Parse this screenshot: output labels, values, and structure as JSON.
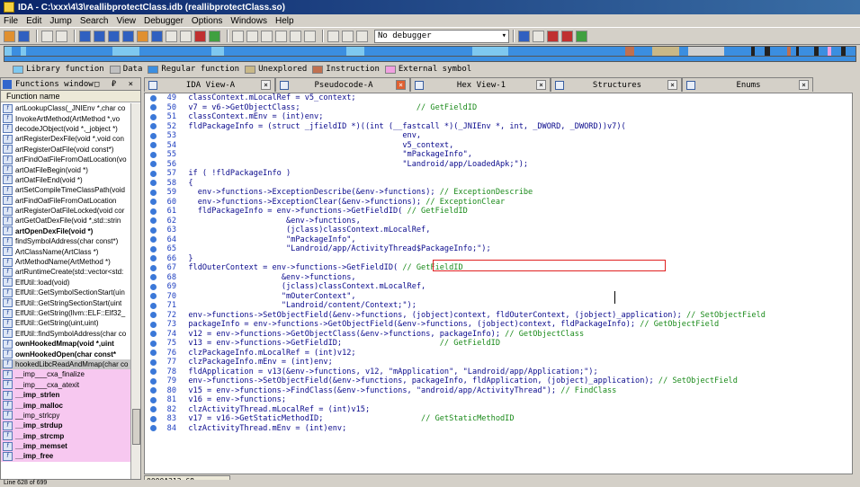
{
  "window": {
    "title": "IDA - C:\\xxx\\4\\3\\reallibprotectClass.idb (reallibprotectClass.so)"
  },
  "menu": [
    "File",
    "Edit",
    "Jump",
    "Search",
    "View",
    "Debugger",
    "Options",
    "Windows",
    "Help"
  ],
  "toolbar": {
    "debugger_select": "No debugger"
  },
  "legend": [
    {
      "label": "Library function",
      "color": "#7ec8f0"
    },
    {
      "label": "Data",
      "color": "#c0c0c0"
    },
    {
      "label": "Regular function",
      "color": "#3b8ee0"
    },
    {
      "label": "Unexplored",
      "color": "#c8b888"
    },
    {
      "label": "Instruction",
      "color": "#c07050"
    },
    {
      "label": "External symbol",
      "color": "#f0a0e0"
    }
  ],
  "functions_window": {
    "title": "Functions window",
    "controls": "□ ₽ ×",
    "column_header": "Function name",
    "items": [
      {
        "name": "artLookupClass(_JNIEnv *,char co",
        "style": ""
      },
      {
        "name": "InvokeArtMethod(ArtMethod *,vo",
        "style": ""
      },
      {
        "name": "decodeJObject(void *,_jobject *)",
        "style": ""
      },
      {
        "name": "artRegisterDexFile(void *,void con",
        "style": ""
      },
      {
        "name": "artRegisterOatFile(void const*)",
        "style": ""
      },
      {
        "name": "artFindOatFileFromOatLocation(vo",
        "style": ""
      },
      {
        "name": "artOatFileBegin(void *)",
        "style": ""
      },
      {
        "name": "artOatFileEnd(void *)",
        "style": ""
      },
      {
        "name": "artSetCompileTimeClassPath(void",
        "style": ""
      },
      {
        "name": "artFindOatFileFromOatLocation",
        "style": ""
      },
      {
        "name": "artRegisterOatFileLocked(void cor",
        "style": ""
      },
      {
        "name": "artGetOatDexFile(void *,std::strin",
        "style": ""
      },
      {
        "name": "artOpenDexFile(void *)",
        "style": "b"
      },
      {
        "name": "findSymbolAddress(char const*)",
        "style": ""
      },
      {
        "name": "ArtClassName(ArtClass *)",
        "style": ""
      },
      {
        "name": "ArtMethodName(ArtMethod *)",
        "style": ""
      },
      {
        "name": "artRuntimeCreate(std::vector<std:",
        "style": ""
      },
      {
        "name": "ElfUtil::load(void)",
        "style": ""
      },
      {
        "name": "ElfUtil::GetSymbolSectionStart(uin",
        "style": ""
      },
      {
        "name": "ElfUtil::GetStringSectionStart(uint",
        "style": ""
      },
      {
        "name": "ElfUtil::GetString(llvm::ELF::Elf32_",
        "style": ""
      },
      {
        "name": "ElfUtil::GetString(uint,uint)",
        "style": ""
      },
      {
        "name": "ElfUtil::findSymbolAddress(char co",
        "style": ""
      },
      {
        "name": "ownHookedMmap(void *,uint",
        "style": "b"
      },
      {
        "name": "ownHookedOpen(char const*",
        "style": "b"
      },
      {
        "name": "hookedLibcReadAndMmap(char co",
        "style": "sel"
      },
      {
        "name": "__imp___cxa_finalize",
        "style": "pink"
      },
      {
        "name": "__imp___cxa_atexit",
        "style": "pink"
      },
      {
        "name": "__imp_strlen",
        "style": "pink b"
      },
      {
        "name": "__imp_malloc",
        "style": "pink b"
      },
      {
        "name": "__imp_strlcpy",
        "style": "pink"
      },
      {
        "name": "__imp_strdup",
        "style": "pink b"
      },
      {
        "name": "__imp_strcmp",
        "style": "pink b"
      },
      {
        "name": "__imp_memset",
        "style": "pink b"
      },
      {
        "name": "__imp_free",
        "style": "pink b"
      }
    ]
  },
  "status": {
    "line_count": "Line 628 of 699",
    "address": "0000A212 68"
  },
  "tabs": [
    {
      "label": "IDA View-A",
      "active": false
    },
    {
      "label": "Pseudocode-A",
      "active": true
    },
    {
      "label": "Hex View-1",
      "active": false
    },
    {
      "label": "Structures",
      "active": false
    },
    {
      "label": "Enums",
      "active": false
    }
  ],
  "code_lines": [
    {
      "n": "49",
      "text": "  classContext.mLocalRef = v5_context;",
      "cm": ""
    },
    {
      "n": "50",
      "text": "  v7 = v6->GetObjectClass;",
      "cm": "                        // GetFieldID"
    },
    {
      "n": "51",
      "text": "  classContext.mEnv = (int)env;",
      "cm": ""
    },
    {
      "n": "52",
      "text": "  fldPackageInfo = (struct _jfieldID *)((int (__fastcall *)(_JNIEnv *, int, _DWORD, _DWORD))v7)(",
      "cm": ""
    },
    {
      "n": "53",
      "text": "                                                env,",
      "cm": ""
    },
    {
      "n": "54",
      "text": "                                                v5_context,",
      "cm": ""
    },
    {
      "n": "55",
      "text": "                                                \"mPackageInfo\",",
      "cm": ""
    },
    {
      "n": "56",
      "text": "                                                \"Landroid/app/LoadedApk;\");",
      "cm": ""
    },
    {
      "n": "57",
      "text": "  if ( !fldPackageInfo )",
      "cm": ""
    },
    {
      "n": "58",
      "text": "  {",
      "cm": ""
    },
    {
      "n": "59",
      "text": "    env->functions->ExceptionDescribe(&env->functions);",
      "cm": "// ExceptionDescribe"
    },
    {
      "n": "60",
      "text": "    env->functions->ExceptionClear(&env->functions);",
      "cm": "// ExceptionClear"
    },
    {
      "n": "61",
      "text": "    fldPackageInfo = env->functions->GetFieldID(",
      "cm": "// GetFieldID"
    },
    {
      "n": "62",
      "text": "                       &env->functions,",
      "cm": ""
    },
    {
      "n": "63",
      "text": "                       (jclass)classContext.mLocalRef,",
      "cm": ""
    },
    {
      "n": "64",
      "text": "                       \"mPackageInfo\",",
      "cm": ""
    },
    {
      "n": "65",
      "text": "                       \"Landroid/app/ActivityThread$PackageInfo;\");",
      "cm": ""
    },
    {
      "n": "66",
      "text": "  }",
      "cm": ""
    },
    {
      "n": "67",
      "text": "  fldOuterContext = env->functions->GetFieldID(",
      "cm": "// GetFieldID"
    },
    {
      "n": "68",
      "text": "                      &env->functions,",
      "cm": ""
    },
    {
      "n": "69",
      "text": "                      (jclass)classContext.mLocalRef,",
      "cm": ""
    },
    {
      "n": "70",
      "text": "                      \"mOuterContext\",",
      "cm": ""
    },
    {
      "n": "71",
      "text": "                      \"Landroid/content/Context;\");",
      "cm": ""
    },
    {
      "n": "72",
      "text": "  env->functions->SetObjectField(&env->functions, (jobject)context, fldOuterContext, (jobject)_application);",
      "cm": "// SetObjectField"
    },
    {
      "n": "73",
      "text": "  packageInfo = env->functions->GetObjectField(&env->functions, (jobject)context, fldPackageInfo);",
      "cm": "// GetObjectField"
    },
    {
      "n": "74",
      "text": "  v12 = env->functions->GetObjectClass(&env->functions, packageInfo);",
      "cm": "// GetObjectClass"
    },
    {
      "n": "75",
      "text": "  v13 = env->functions->GetFieldID;",
      "cm": "                    // GetFieldID"
    },
    {
      "n": "76",
      "text": "  clzPackageInfo.mLocalRef = (int)v12;",
      "cm": ""
    },
    {
      "n": "77",
      "text": "  clzPackageInfo.mEnv = (int)env;",
      "cm": ""
    },
    {
      "n": "78",
      "text": "  fldApplication = v13(&env->functions, v12, \"mApplication\", \"Landroid/app/Application;\");",
      "cm": ""
    },
    {
      "n": "79",
      "text": "  env->functions->SetObjectField(&env->functions, packageInfo, fldApplication, (jobject)_application);",
      "cm": "// SetObjectField"
    },
    {
      "n": "80",
      "text": "  v15 = env->functions->FindClass(&env->functions, \"android/app/ActivityThread\");",
      "cm": "// FindClass"
    },
    {
      "n": "81",
      "text": "  v16 = env->functions;",
      "cm": ""
    },
    {
      "n": "82",
      "text": "  clzActivityThread.mLocalRef = (int)v15;",
      "cm": ""
    },
    {
      "n": "83",
      "text": "  v17 = v16->GetStaticMethodID;",
      "cm": "                    // GetStaticMethodID"
    },
    {
      "n": "84",
      "text": "  clzActivityThread.mEnv = (int)env;",
      "cm": ""
    }
  ]
}
